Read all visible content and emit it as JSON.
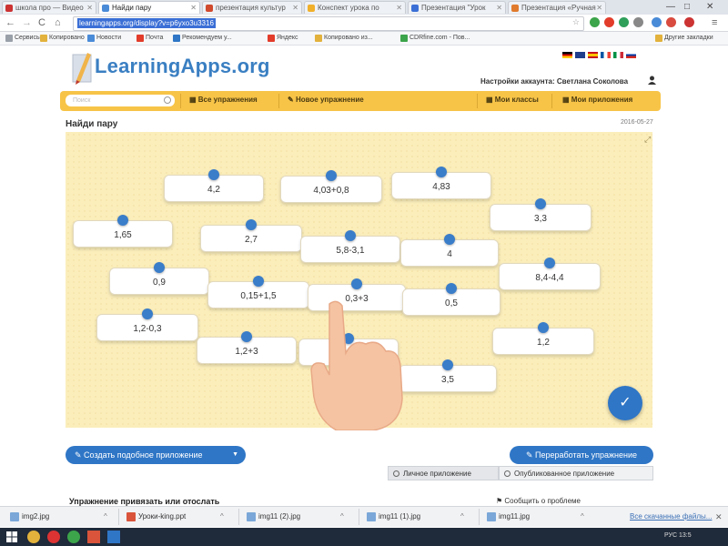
{
  "browser": {
    "tabs": [
      {
        "label": "школа про — Видео"
      },
      {
        "label": "Найди пару"
      },
      {
        "label": "презентация культур"
      },
      {
        "label": "Конспект урока по"
      },
      {
        "label": "Презентация \"Урок"
      },
      {
        "label": "Презентация «Ручная"
      }
    ],
    "window_controls": {
      "minimize": "—",
      "maximize": "□",
      "close": "✕"
    },
    "url": "learningapps.org/display?v=p6yxo3u3316",
    "nav": {
      "back": "←",
      "forward": "→",
      "reload": "C",
      "home": "⌂"
    },
    "bookmarks": [
      {
        "label": "Сервисы"
      },
      {
        "label": "Копировано"
      },
      {
        "label": "Новости"
      },
      {
        "label": "Почта"
      },
      {
        "label": "Рекомендуем у..."
      },
      {
        "label": "Яндекс"
      },
      {
        "label": "Копировано из..."
      },
      {
        "label": "CDRfine.com - Пов..."
      },
      {
        "label": "Другие закладки"
      }
    ]
  },
  "site": {
    "logo_text": "LearningApps.org",
    "account_label": "Настройки аккаунта: Светлана Соколова",
    "search_placeholder": "Поиск",
    "menu": [
      {
        "label": "Все упражнения",
        "icon": "grid-icon"
      },
      {
        "label": "Новое упражнение",
        "icon": "pencil-icon"
      },
      {
        "label": "Мои классы",
        "icon": "grid-icon"
      },
      {
        "label": "Мои приложения",
        "icon": "grid-icon"
      }
    ],
    "flags": [
      "#c8102e",
      "#1f3d8a",
      "#e8b400",
      "#2f8f3a",
      "#d52b1e",
      "#ffffff"
    ]
  },
  "app": {
    "title": "Найди пару",
    "date": "2016-05-27",
    "expand_symbol": "⤢",
    "cards": [
      "4,2",
      "4,03+0,8",
      "4,83",
      "3,3",
      "1,65",
      "2,7",
      "5,8-3,1",
      "4",
      "0,9",
      "0,15+1,5",
      "0,3+3",
      "0,5",
      "8,4-4,4",
      "1,2-0,3",
      "1,2+3",
      "3,5",
      "1,2"
    ],
    "check_symbol": "✓"
  },
  "actions": {
    "create_similar": "Создать подобное приложение",
    "edit": "Переработать упражнение",
    "private_tab": "Личное приложение",
    "public_tab": "Опубликованное приложение"
  },
  "footer": {
    "embed_label": "Упражнение привязать или отослать",
    "report_label": "Сообщить о проблеме"
  },
  "downloads": {
    "items": [
      {
        "label": "img2.jpg"
      },
      {
        "label": "Уроки-king.ppt"
      },
      {
        "label": "img11 (2).jpg"
      },
      {
        "label": "img11 (1).jpg"
      },
      {
        "label": "img11.jpg"
      }
    ],
    "show_all": "Все скачанные файлы...",
    "close_symbol": "✕"
  },
  "taskbar": {
    "lang": "РУС",
    "time": "13:5"
  }
}
